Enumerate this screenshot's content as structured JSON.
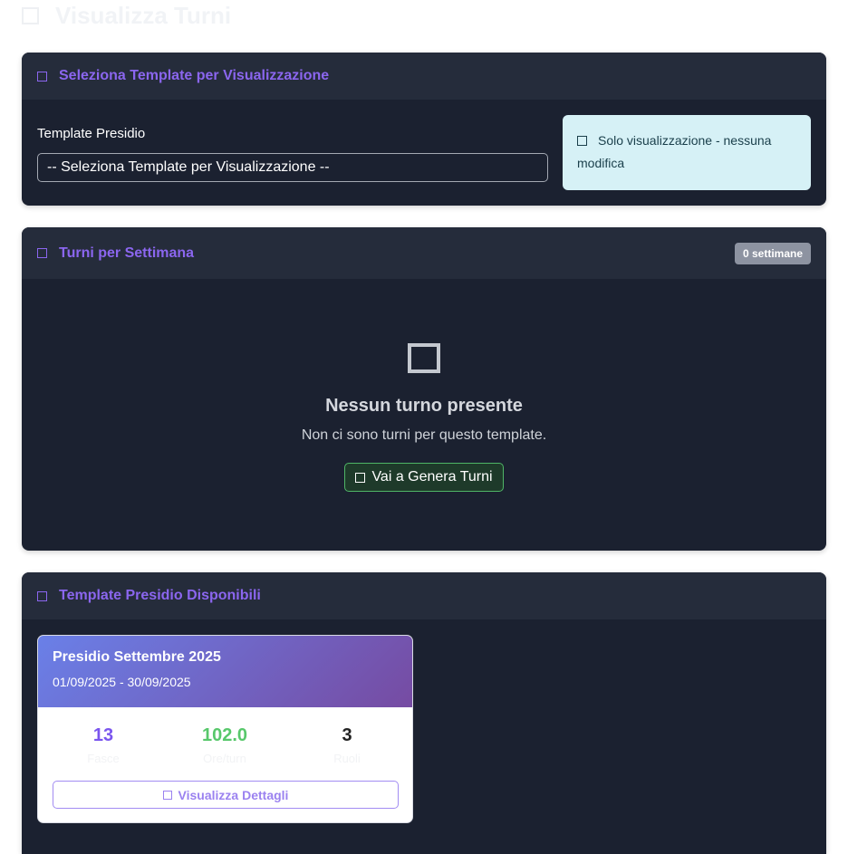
{
  "page": {
    "title": "Visualizza Turni",
    "title_icon": "square-icon"
  },
  "select_card": {
    "header": "Seleziona Template per Visualizzazione",
    "field_label": "Template Presidio",
    "selected_option": "-- Seleziona Template per Visualizzazione --",
    "info": "Solo visualizzazione - nessuna modifica"
  },
  "weeks_card": {
    "header": "Turni per Settimana",
    "badge": "0 settimane",
    "empty_title": "Nessun turno presente",
    "empty_text": "Non ci sono turni per questo template.",
    "generate_button": "Vai a Genera Turni"
  },
  "available_card": {
    "header": "Template Presidio Disponibili",
    "templates": [
      {
        "name": "Presidio Settembre 2025",
        "dates": "01/09/2025 - 30/09/2025",
        "stats": [
          {
            "value": "13",
            "label": "Fasce"
          },
          {
            "value": "102.0",
            "label": "Ore/turn"
          },
          {
            "value": "3",
            "label": "Ruoli"
          }
        ],
        "details_button": "Visualizza Dettagli"
      }
    ]
  },
  "colors": {
    "accent": "#8b66ef",
    "card_bg": "#1b2130",
    "header_bg": "#252c3b",
    "success": "#58c86b",
    "info_bg": "#d6f1f6"
  }
}
